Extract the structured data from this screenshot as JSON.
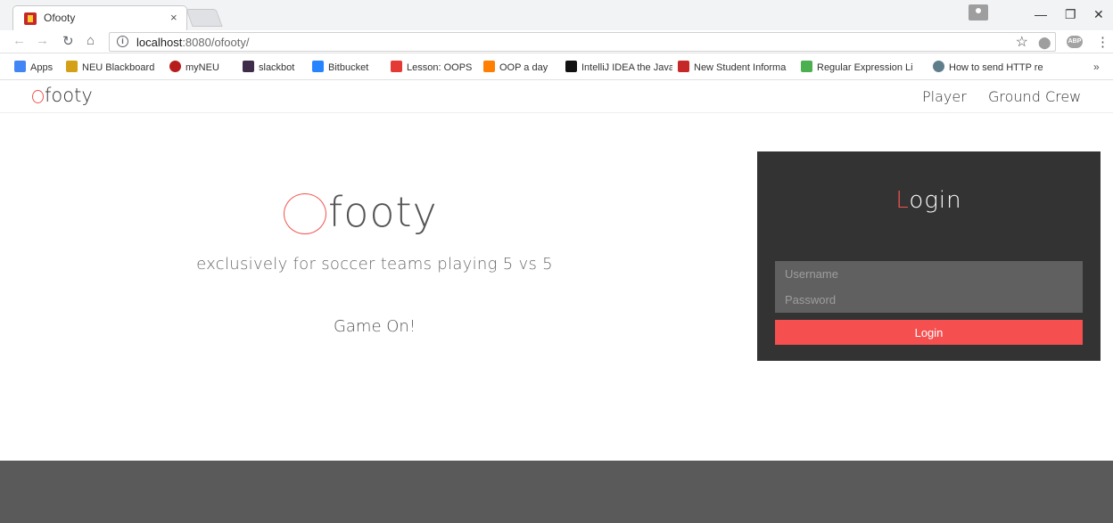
{
  "browser": {
    "tab_title": "Ofooty",
    "tab_close": "×",
    "url_host": "localhost",
    "url_path": ":8080/ofooty/",
    "info_glyph": "i",
    "star_glyph": "☆",
    "menu_glyph": "⋮",
    "ext_label": "ABP",
    "window_controls": {
      "minimize": "—",
      "restore": "❐",
      "close": "✕"
    },
    "bookmarks": [
      {
        "label": "Apps",
        "icon": "apps-grid-icon",
        "color": "#4285f4"
      },
      {
        "label": "NEU Blackboard",
        "icon": "blackboard-icon",
        "color": "#d4a017"
      },
      {
        "label": "myNEU",
        "icon": "paw-icon",
        "color": "#b71c1c"
      },
      {
        "label": "slackbot",
        "icon": "slack-icon",
        "color": "#3e2c4a"
      },
      {
        "label": "Bitbucket",
        "icon": "bitbucket-icon",
        "color": "#2684ff"
      },
      {
        "label": "Lesson: OOPS",
        "icon": "oracle-icon",
        "color": "#e53935"
      },
      {
        "label": "OOP a day",
        "icon": "blogger-icon",
        "color": "#ff7f00"
      },
      {
        "label": "IntelliJ IDEA the Java I",
        "icon": "jetbrains-icon",
        "color": "#111111"
      },
      {
        "label": "New Student Informa",
        "icon": "neu-icon",
        "color": "#c62828"
      },
      {
        "label": "Regular Expression Li",
        "icon": "regex-icon",
        "color": "#4caf50"
      },
      {
        "label": "How to send HTTP re",
        "icon": "link-icon",
        "color": "#607d8b"
      }
    ],
    "bookmarks_more": "»"
  },
  "nav": {
    "brand_rest": "footy",
    "links": [
      "Player",
      "Ground Crew"
    ]
  },
  "hero": {
    "title_rest": "footy",
    "tagline": "exclusively for soccer teams playing 5 vs 5",
    "cta": "Game On!"
  },
  "login": {
    "heading_first": "L",
    "heading_rest": "ogin",
    "username_placeholder": "Username",
    "password_placeholder": "Password",
    "button_label": "Login"
  },
  "colors": {
    "accent": "#f0544f",
    "panel_bg": "#333333",
    "footer_bg": "#5a5a5a",
    "button_bg": "#f54f4f"
  }
}
